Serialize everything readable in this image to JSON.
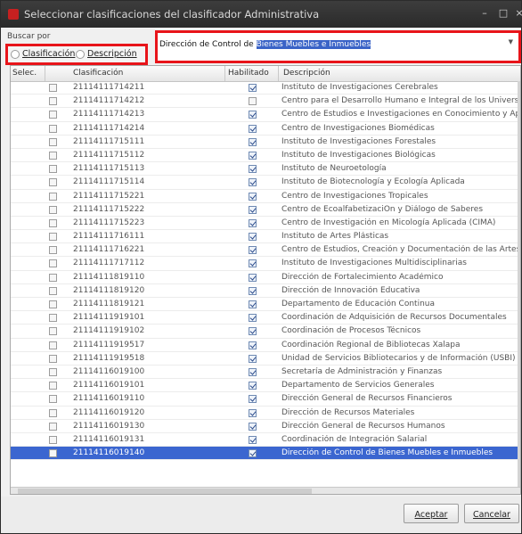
{
  "window": {
    "title": "Seleccionar clasificaciones del clasificador Administrativa"
  },
  "search": {
    "label": "Buscar por",
    "radio_clasificacion": "Clasificación",
    "radio_descripcion": "Descripción",
    "value_prefix": "Dirección de Control de ",
    "value_highlight": "Bienes Muebles e Inmuebles"
  },
  "grid": {
    "headers": {
      "selec": "Selec.",
      "clasificacion": "Clasificación",
      "habilitado": "Habilitado",
      "descripcion": "Descripción"
    },
    "rows": [
      {
        "code": "21114111714211",
        "desc": "Instituto de Investigaciones Cerebrales",
        "hab": true
      },
      {
        "code": "21114111714212",
        "desc": "Centro para el Desarrollo Humano e Integral de los Universitarios",
        "hab": false
      },
      {
        "code": "21114111714213",
        "desc": "Centro de Estudios e Investigaciones en Conocimiento y Aprendiz",
        "hab": true
      },
      {
        "code": "21114111714214",
        "desc": "Centro de Investigaciones Biomédicas",
        "hab": true
      },
      {
        "code": "21114111715111",
        "desc": "Instituto de Investigaciones Forestales",
        "hab": true
      },
      {
        "code": "21114111715112",
        "desc": "Instituto de Investigaciones Biológicas",
        "hab": true
      },
      {
        "code": "21114111715113",
        "desc": "Instituto de Neuroetología",
        "hab": true
      },
      {
        "code": "21114111715114",
        "desc": "Instituto de Biotecnología y Ecología Aplicada",
        "hab": true
      },
      {
        "code": "21114111715221",
        "desc": "Centro de Investigaciones Tropicales",
        "hab": true
      },
      {
        "code": "21114111715222",
        "desc": "Centro de EcoalfabetizaciÓn y Diálogo de Saberes",
        "hab": true
      },
      {
        "code": "21114111715223",
        "desc": "Centro de Investigación en Micología Aplicada (CIMA)",
        "hab": true
      },
      {
        "code": "21114111716111",
        "desc": "Instituto de Artes Plásticas",
        "hab": true
      },
      {
        "code": "21114111716221",
        "desc": "Centro de Estudios, Creación y Documentación de las Artes (CEC",
        "hab": true
      },
      {
        "code": "21114111717112",
        "desc": "Instituto de Investigaciones Multidisciplinarias",
        "hab": true
      },
      {
        "code": "21114111819110",
        "desc": "Dirección de Fortalecimiento Académico",
        "hab": true
      },
      {
        "code": "21114111819120",
        "desc": "Dirección de Innovación Educativa",
        "hab": true
      },
      {
        "code": "21114111819121",
        "desc": "Departamento de Educación Continua",
        "hab": true
      },
      {
        "code": "21114111919101",
        "desc": "Coordinación de Adquisición de Recursos Documentales",
        "hab": true
      },
      {
        "code": "21114111919102",
        "desc": "Coordinación de Procesos Técnicos",
        "hab": true
      },
      {
        "code": "21114111919517",
        "desc": "Coordinación Regional de Bibliotecas Xalapa",
        "hab": true
      },
      {
        "code": "21114111919518",
        "desc": "Unidad de Servicios Bibliotecarios y de Información (USBI) Xalapa",
        "hab": true
      },
      {
        "code": "21114116019100",
        "desc": "Secretaría de Administración y Finanzas",
        "hab": true
      },
      {
        "code": "21114116019101",
        "desc": "Departamento de Servicios Generales",
        "hab": true
      },
      {
        "code": "21114116019110",
        "desc": "Dirección General de Recursos Financieros",
        "hab": true
      },
      {
        "code": "21114116019120",
        "desc": "Dirección de Recursos Materiales",
        "hab": true
      },
      {
        "code": "21114116019130",
        "desc": "Dirección General de Recursos Humanos",
        "hab": true
      },
      {
        "code": "21114116019131",
        "desc": "Coordinación de Integración Salarial",
        "hab": true
      },
      {
        "code": "21114116019140",
        "desc": "Dirección de Control de Bienes Muebles e Inmuebles",
        "hab": true,
        "selected": true
      }
    ]
  },
  "buttons": {
    "ok": "Aceptar",
    "cancel": "Cancelar"
  }
}
